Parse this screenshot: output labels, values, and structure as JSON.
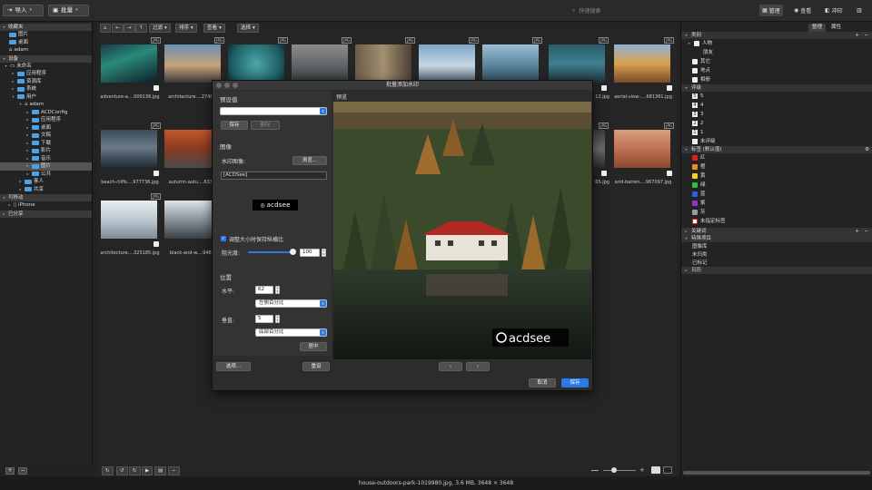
{
  "topbar": {
    "import_label": "导入",
    "batch_label": "批量",
    "search_placeholder": "快速搜索",
    "modes": [
      {
        "label": "管理"
      },
      {
        "label": "查看"
      },
      {
        "label": "冲印"
      }
    ]
  },
  "left_panel": {
    "sections": [
      {
        "label": "收藏夹"
      },
      {
        "label": "设备"
      },
      {
        "label": "可移动"
      },
      {
        "label": "已分享"
      }
    ],
    "favorites": [
      {
        "label": "图片"
      },
      {
        "label": "桌面"
      },
      {
        "label": "adam"
      }
    ],
    "device_tree": [
      {
        "label": "未命名"
      },
      {
        "label": "应用程序"
      },
      {
        "label": "资源库"
      },
      {
        "label": "系统"
      },
      {
        "label": "用户"
      },
      {
        "label": "adam"
      },
      {
        "label": "ACDConfig"
      },
      {
        "label": "应用程序"
      },
      {
        "label": "桌面"
      },
      {
        "label": "文稿"
      },
      {
        "label": "下载"
      },
      {
        "label": "影片"
      },
      {
        "label": "音乐"
      },
      {
        "label": "图片"
      },
      {
        "label": "公共"
      },
      {
        "label": "客人"
      },
      {
        "label": "共享"
      }
    ],
    "removable": [
      {
        "label": "iPhone"
      }
    ],
    "add_label": "+",
    "remove_label": "−"
  },
  "center_toolbar": {
    "filter_label": "过滤",
    "sort_label": "排序",
    "view_label": "查看",
    "select_label": "选择"
  },
  "thumbnails": [
    {
      "badge": "JPG",
      "caption": "adventure-a....009136.jpg"
    },
    {
      "badge": "JPG",
      "caption": "architecture....274882"
    },
    {
      "badge": "JPG",
      "caption": ""
    },
    {
      "badge": "JPG",
      "caption": ""
    },
    {
      "badge": "JPG",
      "caption": ""
    },
    {
      "badge": "JPG",
      "caption": ""
    },
    {
      "badge": "JPG",
      "caption": ""
    },
    {
      "badge": "JPG",
      "caption": "12.jpg"
    },
    {
      "badge": "JPG",
      "caption": "aerial-view-....681361.jpg"
    },
    {
      "badge": "JPG",
      "caption": "beach-cliffs....977736.jpg"
    },
    {
      "badge": "JPG",
      "caption": "autumn-autu....63355"
    },
    {
      "badge": "JPG",
      "caption": "65.jpg"
    },
    {
      "badge": "JPG",
      "caption": "arid-barren....967097.jpg"
    },
    {
      "badge": "JPG",
      "caption": "architecture....325185.jpg"
    },
    {
      "badge": "JPG",
      "caption": "black-and-w....94883"
    }
  ],
  "dialog": {
    "title": "批量添加水印",
    "preset_heading": "预设值",
    "preset_value": "",
    "save_label": "保存",
    "delete_label": "删除",
    "image_heading": "图像",
    "watermark_image_label": "水印图像:",
    "browse_label": "浏览...",
    "watermark_path": "[ACDSee]",
    "logo_text": "acdsee",
    "keep_ratio_label": "调整大小时保持纵横比",
    "keep_ratio_checked": true,
    "opacity_label": "阻光度:",
    "opacity_value": "100",
    "opacity_fraction": 0.95,
    "position_heading": "位置",
    "horizontal_label": "水平:",
    "horizontal_value": "62",
    "horizontal_mode": "左侧百分比",
    "vertical_label": "垂直:",
    "vertical_value": "5",
    "vertical_mode": "底部百分比",
    "center_label": "居中",
    "options_label": "选项...",
    "reset_label": "重设",
    "preview_heading": "预览",
    "prev_label": "‹",
    "next_label": "›",
    "cancel_label": "取消",
    "ok_label": "保存"
  },
  "right_panel": {
    "tabs": [
      {
        "label": "整理"
      },
      {
        "label": "属性"
      }
    ],
    "category_heading": "类别",
    "categories": [
      {
        "label": "人物"
      },
      {
        "label": "朋友"
      },
      {
        "label": "其它"
      },
      {
        "label": "地点"
      },
      {
        "label": "相册"
      }
    ],
    "rating_heading": "评级",
    "ratings": [
      {
        "num": "5",
        "label": "5"
      },
      {
        "num": "4",
        "label": "4"
      },
      {
        "num": "3",
        "label": "3"
      },
      {
        "num": "2",
        "label": "2"
      },
      {
        "num": "1",
        "label": "1"
      },
      {
        "num": "",
        "label": "未评级"
      }
    ],
    "labels_heading": "标签 (默认值)",
    "labels": [
      {
        "label": "红",
        "color": "#e02020"
      },
      {
        "label": "橙",
        "color": "#f08a1c"
      },
      {
        "label": "黄",
        "color": "#f2d21c"
      },
      {
        "label": "绿",
        "color": "#2fbf3a"
      },
      {
        "label": "蓝",
        "color": "#2a5fe0"
      },
      {
        "label": "紫",
        "color": "#9a2fd0"
      },
      {
        "label": "灰",
        "color": "#9a9a9a"
      },
      {
        "label": "未指定标签",
        "color": "#ffffff"
      }
    ],
    "keywords_heading": "关键词",
    "special_heading": "特殊项目",
    "special_items": [
      {
        "label": "图像库"
      },
      {
        "label": "未归类"
      },
      {
        "label": "已标记"
      }
    ],
    "calendar_label": "日历"
  },
  "status_bar": {
    "text": "house-outdoors-park-1019980.jpg, 3.6 MB, 3648 × 3648"
  }
}
